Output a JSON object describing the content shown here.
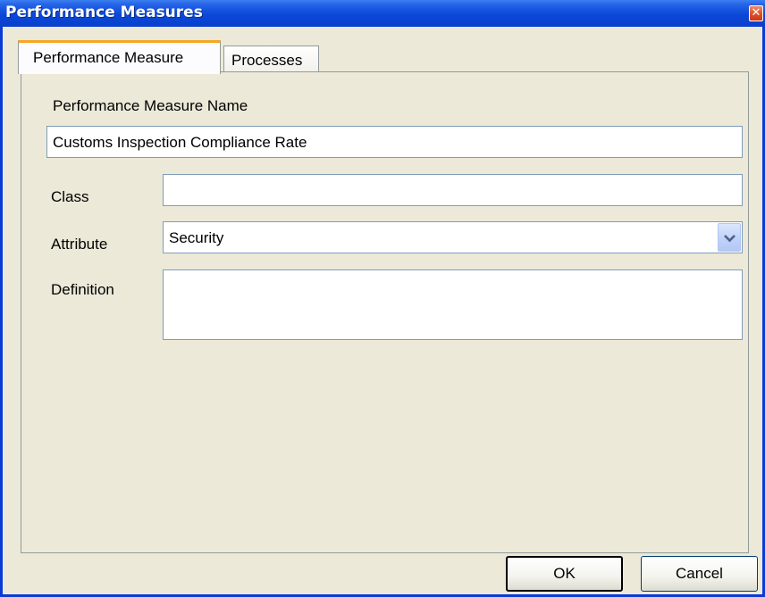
{
  "window": {
    "title": "Performance Measures",
    "close_glyph": "✕"
  },
  "tabs": [
    {
      "label": "Performance Measure",
      "active": true
    },
    {
      "label": "Processes",
      "active": false
    }
  ],
  "form": {
    "name_label": "Performance Measure Name",
    "name_value": "Customs Inspection Compliance Rate",
    "class_label": "Class",
    "class_value": "",
    "attribute_label": "Attribute",
    "attribute_value": "Security",
    "definition_label": "Definition",
    "definition_value": ""
  },
  "buttons": {
    "ok_label": "OK",
    "cancel_label": "Cancel"
  },
  "colors": {
    "accent": "#0a3bd6",
    "tab_highlight": "#f5a623",
    "window_bg": "#ece9d8"
  },
  "icons": {
    "close": "close-icon",
    "dropdown": "chevron-down-icon"
  }
}
